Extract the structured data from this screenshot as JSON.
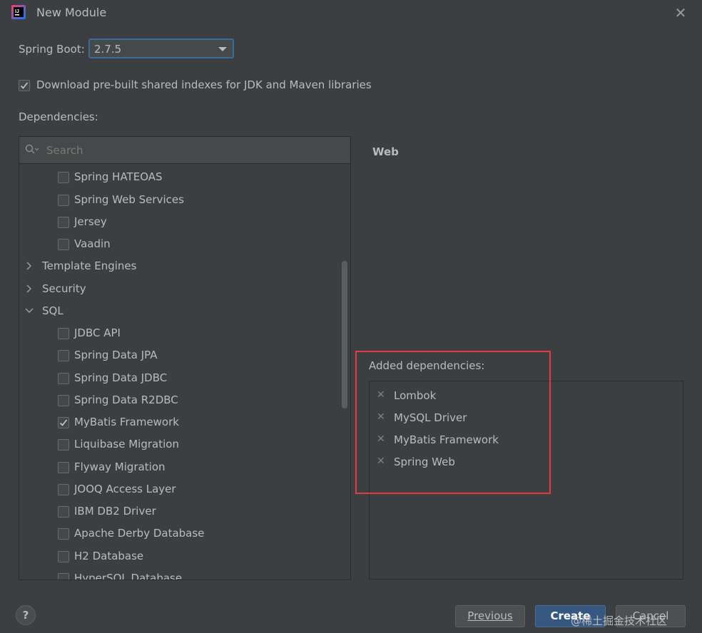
{
  "window": {
    "title": "New Module"
  },
  "spring_boot": {
    "label": "Spring Boot:",
    "selected": "2.7.5"
  },
  "download_indexes": {
    "checked": true,
    "label": "Download pre-built shared indexes for JDK and Maven libraries"
  },
  "dependencies": {
    "label": "Dependencies:",
    "search_placeholder": "Search",
    "rows": [
      {
        "kind": "item",
        "label": "Spring HATEOAS",
        "checked": false
      },
      {
        "kind": "item",
        "label": "Spring Web Services",
        "checked": false
      },
      {
        "kind": "item",
        "label": "Jersey",
        "checked": false
      },
      {
        "kind": "item",
        "label": "Vaadin",
        "checked": false
      },
      {
        "kind": "category",
        "label": "Template Engines",
        "expanded": false
      },
      {
        "kind": "category",
        "label": "Security",
        "expanded": false
      },
      {
        "kind": "category",
        "label": "SQL",
        "expanded": true
      },
      {
        "kind": "item",
        "label": "JDBC API",
        "checked": false
      },
      {
        "kind": "item",
        "label": "Spring Data JPA",
        "checked": false
      },
      {
        "kind": "item",
        "label": "Spring Data JDBC",
        "checked": false
      },
      {
        "kind": "item",
        "label": "Spring Data R2DBC",
        "checked": false
      },
      {
        "kind": "item",
        "label": "MyBatis Framework",
        "checked": true
      },
      {
        "kind": "item",
        "label": "Liquibase Migration",
        "checked": false
      },
      {
        "kind": "item",
        "label": "Flyway Migration",
        "checked": false
      },
      {
        "kind": "item",
        "label": "JOOQ Access Layer",
        "checked": false
      },
      {
        "kind": "item",
        "label": "IBM DB2 Driver",
        "checked": false
      },
      {
        "kind": "item",
        "label": "Apache Derby Database",
        "checked": false
      },
      {
        "kind": "item",
        "label": "H2 Database",
        "checked": false
      },
      {
        "kind": "item",
        "label": "HyperSQL Database",
        "checked": false
      }
    ]
  },
  "detail": {
    "heading": "Web"
  },
  "added": {
    "label": "Added dependencies:",
    "items": [
      "Lombok",
      "MySQL Driver",
      "MyBatis Framework",
      "Spring Web"
    ]
  },
  "buttons": {
    "help": "?",
    "previous": "Previous",
    "create": "Create",
    "cancel": "Cancel"
  },
  "watermark": "@稀土掘金技术社区",
  "colors": {
    "accent": "#365880",
    "highlight": "#e33c3c",
    "background": "#3c3f41"
  }
}
